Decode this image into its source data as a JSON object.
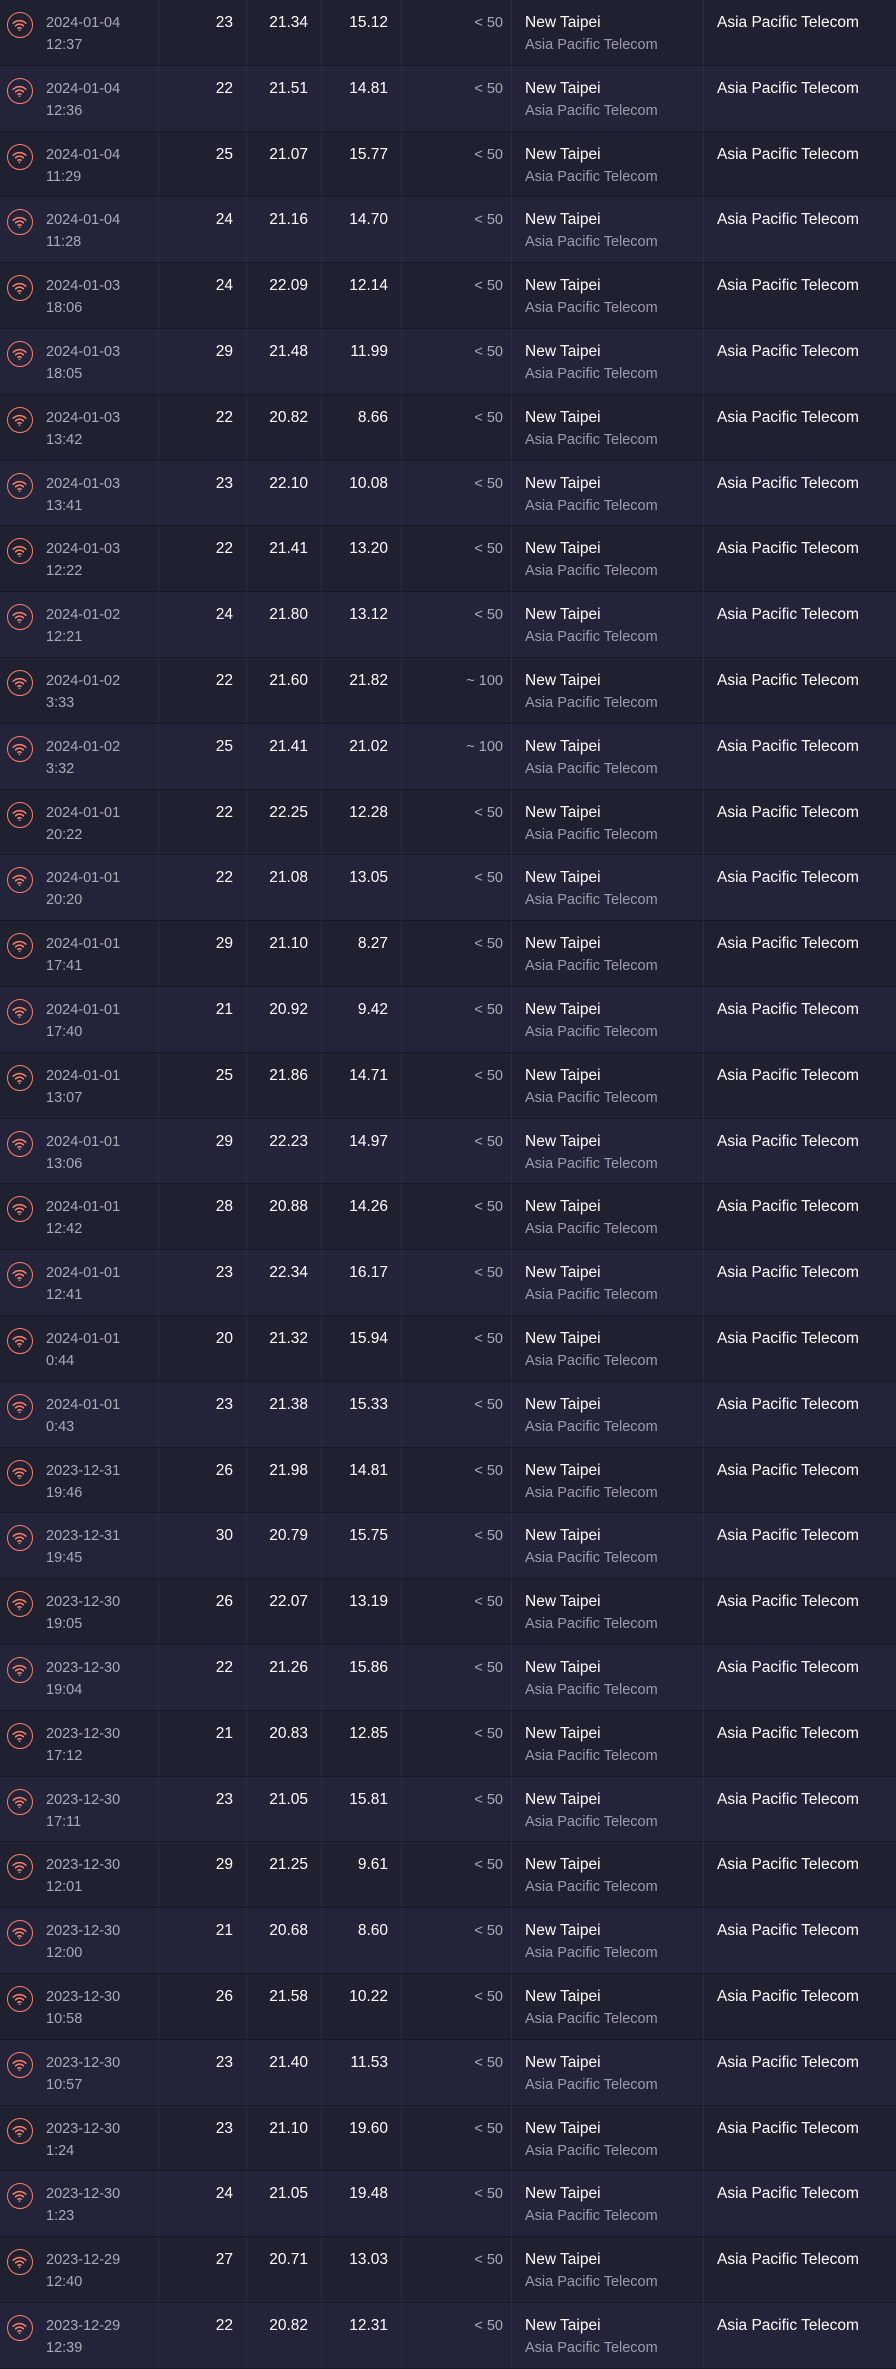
{
  "colors": {
    "accent": "#ff7e67",
    "background": "#1c1d2c",
    "text": "#ffffff",
    "muted": "#a9aab8"
  },
  "rows": [
    {
      "icon": "wifi-icon",
      "date": "2024-01-04",
      "time": "12:37",
      "ping": "23",
      "download": "21.34",
      "upload": "15.12",
      "price": "< 50",
      "location": "New Taipei",
      "location_isp": "Asia Pacific Telecom",
      "isp": "Asia Pacific Telecom"
    },
    {
      "icon": "wifi-icon",
      "date": "2024-01-04",
      "time": "12:36",
      "ping": "22",
      "download": "21.51",
      "upload": "14.81",
      "price": "< 50",
      "location": "New Taipei",
      "location_isp": "Asia Pacific Telecom",
      "isp": "Asia Pacific Telecom"
    },
    {
      "icon": "wifi-icon",
      "date": "2024-01-04",
      "time": "11:29",
      "ping": "25",
      "download": "21.07",
      "upload": "15.77",
      "price": "< 50",
      "location": "New Taipei",
      "location_isp": "Asia Pacific Telecom",
      "isp": "Asia Pacific Telecom"
    },
    {
      "icon": "wifi-icon",
      "date": "2024-01-04",
      "time": "11:28",
      "ping": "24",
      "download": "21.16",
      "upload": "14.70",
      "price": "< 50",
      "location": "New Taipei",
      "location_isp": "Asia Pacific Telecom",
      "isp": "Asia Pacific Telecom"
    },
    {
      "icon": "wifi-icon",
      "date": "2024-01-03",
      "time": "18:06",
      "ping": "24",
      "download": "22.09",
      "upload": "12.14",
      "price": "< 50",
      "location": "New Taipei",
      "location_isp": "Asia Pacific Telecom",
      "isp": "Asia Pacific Telecom"
    },
    {
      "icon": "wifi-icon",
      "date": "2024-01-03",
      "time": "18:05",
      "ping": "29",
      "download": "21.48",
      "upload": "11.99",
      "price": "< 50",
      "location": "New Taipei",
      "location_isp": "Asia Pacific Telecom",
      "isp": "Asia Pacific Telecom"
    },
    {
      "icon": "wifi-icon",
      "date": "2024-01-03",
      "time": "13:42",
      "ping": "22",
      "download": "20.82",
      "upload": "8.66",
      "price": "< 50",
      "location": "New Taipei",
      "location_isp": "Asia Pacific Telecom",
      "isp": "Asia Pacific Telecom"
    },
    {
      "icon": "wifi-icon",
      "date": "2024-01-03",
      "time": "13:41",
      "ping": "23",
      "download": "22.10",
      "upload": "10.08",
      "price": "< 50",
      "location": "New Taipei",
      "location_isp": "Asia Pacific Telecom",
      "isp": "Asia Pacific Telecom"
    },
    {
      "icon": "wifi-icon",
      "date": "2024-01-03",
      "time": "12:22",
      "ping": "22",
      "download": "21.41",
      "upload": "13.20",
      "price": "< 50",
      "location": "New Taipei",
      "location_isp": "Asia Pacific Telecom",
      "isp": "Asia Pacific Telecom"
    },
    {
      "icon": "wifi-icon",
      "date": "2024-01-02",
      "time": "12:21",
      "ping": "24",
      "download": "21.80",
      "upload": "13.12",
      "price": "< 50",
      "location": "New Taipei",
      "location_isp": "Asia Pacific Telecom",
      "isp": "Asia Pacific Telecom"
    },
    {
      "icon": "wifi-icon",
      "date": "2024-01-02",
      "time": "3:33",
      "ping": "22",
      "download": "21.60",
      "upload": "21.82",
      "price": "~ 100",
      "location": "New Taipei",
      "location_isp": "Asia Pacific Telecom",
      "isp": "Asia Pacific Telecom"
    },
    {
      "icon": "wifi-icon",
      "date": "2024-01-02",
      "time": "3:32",
      "ping": "25",
      "download": "21.41",
      "upload": "21.02",
      "price": "~ 100",
      "location": "New Taipei",
      "location_isp": "Asia Pacific Telecom",
      "isp": "Asia Pacific Telecom"
    },
    {
      "icon": "wifi-icon",
      "date": "2024-01-01",
      "time": "20:22",
      "ping": "22",
      "download": "22.25",
      "upload": "12.28",
      "price": "< 50",
      "location": "New Taipei",
      "location_isp": "Asia Pacific Telecom",
      "isp": "Asia Pacific Telecom"
    },
    {
      "icon": "wifi-icon",
      "date": "2024-01-01",
      "time": "20:20",
      "ping": "22",
      "download": "21.08",
      "upload": "13.05",
      "price": "< 50",
      "location": "New Taipei",
      "location_isp": "Asia Pacific Telecom",
      "isp": "Asia Pacific Telecom"
    },
    {
      "icon": "wifi-icon",
      "date": "2024-01-01",
      "time": "17:41",
      "ping": "29",
      "download": "21.10",
      "upload": "8.27",
      "price": "< 50",
      "location": "New Taipei",
      "location_isp": "Asia Pacific Telecom",
      "isp": "Asia Pacific Telecom"
    },
    {
      "icon": "wifi-icon",
      "date": "2024-01-01",
      "time": "17:40",
      "ping": "21",
      "download": "20.92",
      "upload": "9.42",
      "price": "< 50",
      "location": "New Taipei",
      "location_isp": "Asia Pacific Telecom",
      "isp": "Asia Pacific Telecom"
    },
    {
      "icon": "wifi-icon",
      "date": "2024-01-01",
      "time": "13:07",
      "ping": "25",
      "download": "21.86",
      "upload": "14.71",
      "price": "< 50",
      "location": "New Taipei",
      "location_isp": "Asia Pacific Telecom",
      "isp": "Asia Pacific Telecom"
    },
    {
      "icon": "wifi-icon",
      "date": "2024-01-01",
      "time": "13:06",
      "ping": "29",
      "download": "22.23",
      "upload": "14.97",
      "price": "< 50",
      "location": "New Taipei",
      "location_isp": "Asia Pacific Telecom",
      "isp": "Asia Pacific Telecom"
    },
    {
      "icon": "wifi-icon",
      "date": "2024-01-01",
      "time": "12:42",
      "ping": "28",
      "download": "20.88",
      "upload": "14.26",
      "price": "< 50",
      "location": "New Taipei",
      "location_isp": "Asia Pacific Telecom",
      "isp": "Asia Pacific Telecom"
    },
    {
      "icon": "wifi-icon",
      "date": "2024-01-01",
      "time": "12:41",
      "ping": "23",
      "download": "22.34",
      "upload": "16.17",
      "price": "< 50",
      "location": "New Taipei",
      "location_isp": "Asia Pacific Telecom",
      "isp": "Asia Pacific Telecom"
    },
    {
      "icon": "wifi-icon",
      "date": "2024-01-01",
      "time": "0:44",
      "ping": "20",
      "download": "21.32",
      "upload": "15.94",
      "price": "< 50",
      "location": "New Taipei",
      "location_isp": "Asia Pacific Telecom",
      "isp": "Asia Pacific Telecom"
    },
    {
      "icon": "wifi-icon",
      "date": "2024-01-01",
      "time": "0:43",
      "ping": "23",
      "download": "21.38",
      "upload": "15.33",
      "price": "< 50",
      "location": "New Taipei",
      "location_isp": "Asia Pacific Telecom",
      "isp": "Asia Pacific Telecom"
    },
    {
      "icon": "wifi-icon",
      "date": "2023-12-31",
      "time": "19:46",
      "ping": "26",
      "download": "21.98",
      "upload": "14.81",
      "price": "< 50",
      "location": "New Taipei",
      "location_isp": "Asia Pacific Telecom",
      "isp": "Asia Pacific Telecom"
    },
    {
      "icon": "wifi-icon",
      "date": "2023-12-31",
      "time": "19:45",
      "ping": "30",
      "download": "20.79",
      "upload": "15.75",
      "price": "< 50",
      "location": "New Taipei",
      "location_isp": "Asia Pacific Telecom",
      "isp": "Asia Pacific Telecom"
    },
    {
      "icon": "wifi-icon",
      "date": "2023-12-30",
      "time": "19:05",
      "ping": "26",
      "download": "22.07",
      "upload": "13.19",
      "price": "< 50",
      "location": "New Taipei",
      "location_isp": "Asia Pacific Telecom",
      "isp": "Asia Pacific Telecom"
    },
    {
      "icon": "wifi-icon",
      "date": "2023-12-30",
      "time": "19:04",
      "ping": "22",
      "download": "21.26",
      "upload": "15.86",
      "price": "< 50",
      "location": "New Taipei",
      "location_isp": "Asia Pacific Telecom",
      "isp": "Asia Pacific Telecom"
    },
    {
      "icon": "wifi-icon",
      "date": "2023-12-30",
      "time": "17:12",
      "ping": "21",
      "download": "20.83",
      "upload": "12.85",
      "price": "< 50",
      "location": "New Taipei",
      "location_isp": "Asia Pacific Telecom",
      "isp": "Asia Pacific Telecom"
    },
    {
      "icon": "wifi-icon",
      "date": "2023-12-30",
      "time": "17:11",
      "ping": "23",
      "download": "21.05",
      "upload": "15.81",
      "price": "< 50",
      "location": "New Taipei",
      "location_isp": "Asia Pacific Telecom",
      "isp": "Asia Pacific Telecom"
    },
    {
      "icon": "wifi-icon",
      "date": "2023-12-30",
      "time": "12:01",
      "ping": "29",
      "download": "21.25",
      "upload": "9.61",
      "price": "< 50",
      "location": "New Taipei",
      "location_isp": "Asia Pacific Telecom",
      "isp": "Asia Pacific Telecom"
    },
    {
      "icon": "wifi-icon",
      "date": "2023-12-30",
      "time": "12:00",
      "ping": "21",
      "download": "20.68",
      "upload": "8.60",
      "price": "< 50",
      "location": "New Taipei",
      "location_isp": "Asia Pacific Telecom",
      "isp": "Asia Pacific Telecom"
    },
    {
      "icon": "wifi-icon",
      "date": "2023-12-30",
      "time": "10:58",
      "ping": "26",
      "download": "21.58",
      "upload": "10.22",
      "price": "< 50",
      "location": "New Taipei",
      "location_isp": "Asia Pacific Telecom",
      "isp": "Asia Pacific Telecom"
    },
    {
      "icon": "wifi-icon",
      "date": "2023-12-30",
      "time": "10:57",
      "ping": "23",
      "download": "21.40",
      "upload": "11.53",
      "price": "< 50",
      "location": "New Taipei",
      "location_isp": "Asia Pacific Telecom",
      "isp": "Asia Pacific Telecom"
    },
    {
      "icon": "wifi-icon",
      "date": "2023-12-30",
      "time": "1:24",
      "ping": "23",
      "download": "21.10",
      "upload": "19.60",
      "price": "< 50",
      "location": "New Taipei",
      "location_isp": "Asia Pacific Telecom",
      "isp": "Asia Pacific Telecom"
    },
    {
      "icon": "wifi-icon",
      "date": "2023-12-30",
      "time": "1:23",
      "ping": "24",
      "download": "21.05",
      "upload": "19.48",
      "price": "< 50",
      "location": "New Taipei",
      "location_isp": "Asia Pacific Telecom",
      "isp": "Asia Pacific Telecom"
    },
    {
      "icon": "wifi-icon",
      "date": "2023-12-29",
      "time": "12:40",
      "ping": "27",
      "download": "20.71",
      "upload": "13.03",
      "price": "< 50",
      "location": "New Taipei",
      "location_isp": "Asia Pacific Telecom",
      "isp": "Asia Pacific Telecom"
    },
    {
      "icon": "wifi-icon",
      "date": "2023-12-29",
      "time": "12:39",
      "ping": "22",
      "download": "20.82",
      "upload": "12.31",
      "price": "< 50",
      "location": "New Taipei",
      "location_isp": "Asia Pacific Telecom",
      "isp": "Asia Pacific Telecom"
    }
  ]
}
